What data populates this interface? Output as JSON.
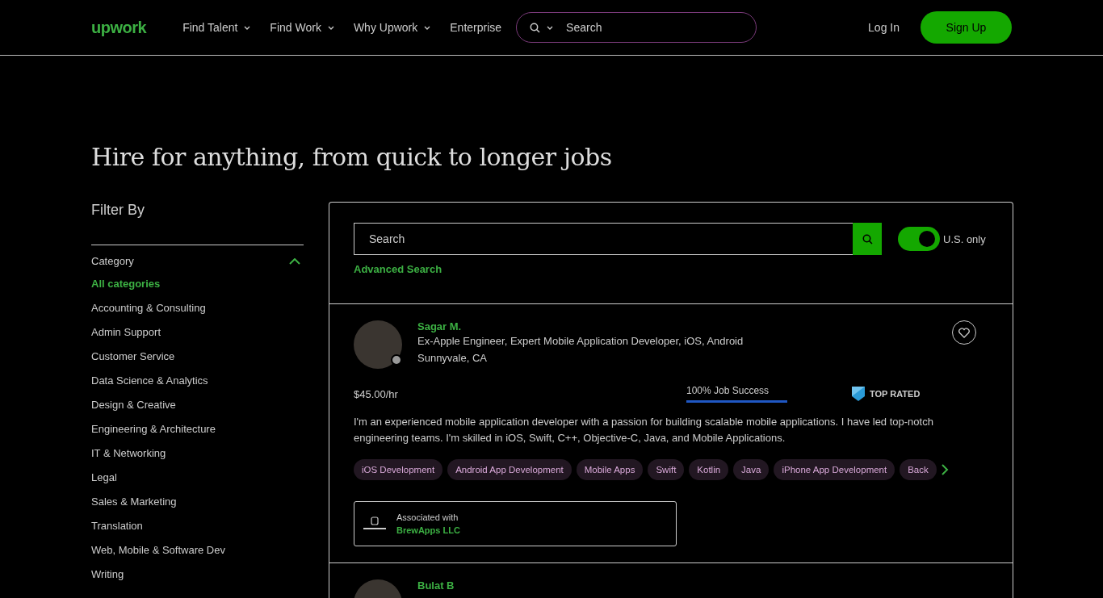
{
  "header": {
    "logo": "upwork",
    "nav": [
      {
        "label": "Find Talent",
        "dropdown": true
      },
      {
        "label": "Find Work",
        "dropdown": true
      },
      {
        "label": "Why Upwork",
        "dropdown": true
      },
      {
        "label": "Enterprise",
        "dropdown": false
      }
    ],
    "search": {
      "placeholder": "Search"
    },
    "login": "Log In",
    "signup": "Sign Up"
  },
  "heading": "Hire for anything, from quick to longer jobs",
  "filter": {
    "title": "Filter By",
    "section": "Category",
    "expanded": true,
    "items": [
      {
        "label": "All categories",
        "selected": true
      },
      {
        "label": "Accounting & Consulting",
        "selected": false
      },
      {
        "label": "Admin Support",
        "selected": false
      },
      {
        "label": "Customer Service",
        "selected": false
      },
      {
        "label": "Data Science & Analytics",
        "selected": false
      },
      {
        "label": "Design & Creative",
        "selected": false
      },
      {
        "label": "Engineering & Architecture",
        "selected": false
      },
      {
        "label": "IT & Networking",
        "selected": false
      },
      {
        "label": "Legal",
        "selected": false
      },
      {
        "label": "Sales & Marketing",
        "selected": false
      },
      {
        "label": "Translation",
        "selected": false
      },
      {
        "label": "Web, Mobile & Software Dev",
        "selected": false
      },
      {
        "label": "Writing",
        "selected": false
      }
    ]
  },
  "search_panel": {
    "placeholder": "Search",
    "us_only": {
      "label": "U.S. only",
      "on": true
    },
    "advanced": "Advanced Search"
  },
  "freelancers": [
    {
      "name": "Sagar M.",
      "title": "Ex-Apple Engineer, Expert Mobile Application Developer, iOS, Android",
      "location": "Sunnyvale, CA",
      "online": false,
      "rate": "$45.00/hr",
      "job_success": {
        "label": "100% Job Success",
        "level": 1
      },
      "badge": "TOP RATED",
      "description": "I'm an experienced mobile application developer with a passion for building scalable mobile applications. I have led top-notch engineering teams. I'm skilled in iOS, Swift, C++, Objective-C, Java, and Mobile Applications.",
      "skills": [
        "iOS Development",
        "Android App Development",
        "Mobile Apps",
        "Swift",
        "Kotlin",
        "Java",
        "iPhone App Development",
        "Back"
      ],
      "agency": {
        "caption": "Associated with",
        "name": "BrewApps LLC"
      }
    },
    {
      "name": "Bulat B"
    }
  ]
}
